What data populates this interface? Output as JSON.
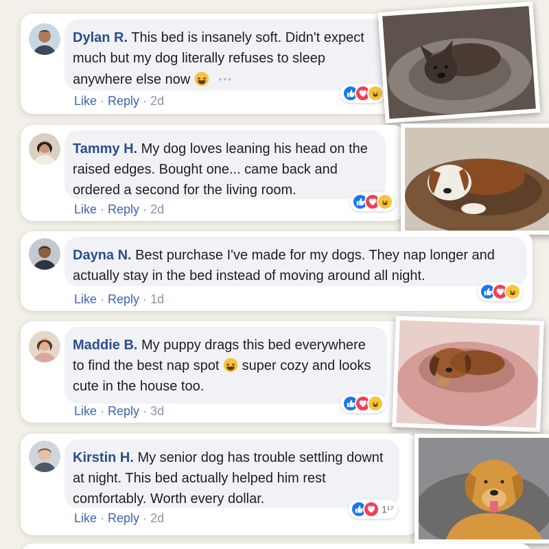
{
  "comments": [
    {
      "author": "Dylan R.",
      "text": "This bed is insanely soft. Didn't expect much but my dog literally refuses to sleep anywhere else now",
      "emoji_icon": "laughing-emoji-icon",
      "like_label": "Like",
      "reply_label": "Reply",
      "time": "2d",
      "reactions": [
        "like",
        "love",
        "haha"
      ],
      "reaction_count": "",
      "photo": "brindle-dog-on-gray-bed"
    },
    {
      "author": "Tammy H.",
      "text": "My dog loves leaning his head on the raised edges. Bought one... came back and ordered a second for the living room.",
      "like_label": "Like",
      "reply_label": "Reply",
      "time": "2d",
      "reactions": [
        "like",
        "love",
        "haha"
      ],
      "reaction_count": "",
      "photo": "brown-white-dog-on-brown-bed"
    },
    {
      "author": "Dayna N.",
      "text": "Best purchase I've made for my dogs. They nap longer and actually stay in the bed instead of moving around all night.",
      "like_label": "Like",
      "reply_label": "Reply",
      "time": "1d",
      "reactions": [
        "like",
        "love",
        "haha"
      ],
      "reaction_count": ""
    },
    {
      "author": "Maddie B.",
      "text_before": "My puppy drags this bed everywhere to find the best nap spot",
      "emoji_icon": "smiling-emoji-icon",
      "text_after": "super cozy and looks cute in the house too.",
      "like_label": "Like",
      "reply_label": "Reply",
      "time": "3d",
      "reactions": [
        "like",
        "love",
        "haha"
      ],
      "reaction_count": "",
      "photo": "puppy-on-pink-bed"
    },
    {
      "author": "Kirstin H.",
      "text": "My senior dog has trouble settling downt at night. This bed actually helped him rest comfortably. Worth every dollar.",
      "like_label": "Like",
      "reply_label": "Reply",
      "time": "2d",
      "reactions": [
        "like",
        "love"
      ],
      "reaction_count": "1¹⁷",
      "photo": "golden-retriever-on-gray-bed"
    }
  ],
  "colors": {
    "background": "#f3efe9",
    "author": "#2a4d8f",
    "action_link": "#3a63b8",
    "like": "#1877f2",
    "love": "#f33e58",
    "haha": "#f7c33a"
  }
}
